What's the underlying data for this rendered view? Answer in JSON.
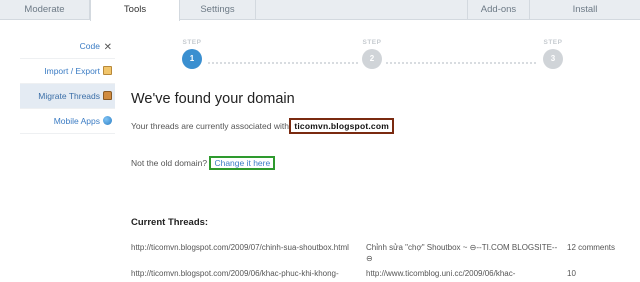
{
  "tabs": [
    {
      "label": "Moderate"
    },
    {
      "label": "Tools"
    },
    {
      "label": "Settings"
    },
    {
      "label": "Add-ons"
    },
    {
      "label": "Install"
    }
  ],
  "sidebar": {
    "items": [
      {
        "label": "Code",
        "icon": "wrench-icon"
      },
      {
        "label": "Import / Export",
        "icon": "box-icon"
      },
      {
        "label": "Migrate Threads",
        "icon": "lock-icon"
      },
      {
        "label": "Mobile Apps",
        "icon": "globe-icon"
      }
    ]
  },
  "steps": [
    {
      "label": "STEP",
      "number": "1"
    },
    {
      "label": "STEP",
      "number": "2"
    },
    {
      "label": "STEP",
      "number": "3"
    }
  ],
  "main": {
    "heading": "We've found your domain",
    "assoc_text": "Your threads are currently associated with",
    "domain": "ticomvn.blogspot.com",
    "old_domain_text": "Not the old domain?",
    "change_link": "Change it here",
    "threads_title": "Current Threads:"
  },
  "threads": [
    {
      "url": "http://ticomvn.blogspot.com/2009/07/chinh-sua-shoutbox.html",
      "title": "Chỉnh sửa \"chợ\" Shoutbox ~ ⊖--TI.COM BLOGSITE--⊖",
      "count": "12 comments"
    },
    {
      "url": "http://ticomvn.blogspot.com/2009/06/khac-phuc-khi-khong-",
      "title": "http://www.ticomblog.uni.cc/2009/06/khac-",
      "count": "10"
    }
  ],
  "colors": {
    "accent": "#3a8fd0",
    "link": "#3b7cc4",
    "domain_box": "#7a2a10",
    "change_box": "#2e9a2e"
  }
}
